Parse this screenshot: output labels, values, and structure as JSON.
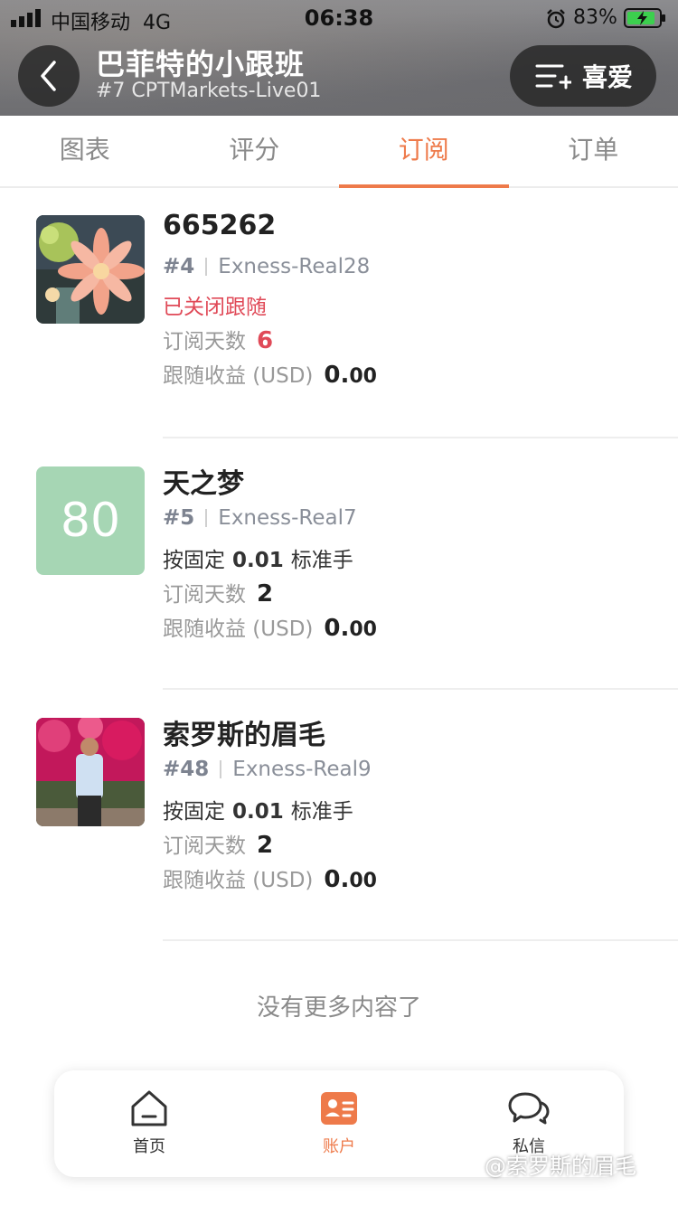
{
  "status_bar": {
    "carrier": "中国移动",
    "network": "4G",
    "time": "06:38",
    "battery": "83%"
  },
  "header": {
    "title": "巴菲特的小跟班",
    "subtitle": "#7 CPTMarkets-Live01",
    "favorite_label": "喜爱"
  },
  "tabs": [
    {
      "label": "图表",
      "active": false
    },
    {
      "label": "评分",
      "active": false
    },
    {
      "label": "订阅",
      "active": true
    },
    {
      "label": "订单",
      "active": false
    }
  ],
  "subscriptions": [
    {
      "name": "665262",
      "rank": "#4",
      "account": "Exness-Real28",
      "status": "已关闭跟随",
      "days_label": "订阅天数",
      "days": "6",
      "profit_label": "跟随收益 (USD)",
      "profit_int": "0.",
      "profit_dec": "00"
    },
    {
      "name": "天之梦",
      "avatar_text": "80",
      "rank": "#5",
      "account": "Exness-Real7",
      "mode_prefix": "按固定",
      "mode_value": "0.01",
      "mode_suffix": "标准手",
      "days_label": "订阅天数",
      "days": "2",
      "profit_label": "跟随收益 (USD)",
      "profit_int": "0.",
      "profit_dec": "00"
    },
    {
      "name": "索罗斯的眉毛",
      "rank": "#48",
      "account": "Exness-Real9",
      "mode_prefix": "按固定",
      "mode_value": "0.01",
      "mode_suffix": "标准手",
      "days_label": "订阅天数",
      "days": "2",
      "profit_label": "跟随收益 (USD)",
      "profit_int": "0.",
      "profit_dec": "00"
    }
  ],
  "end_text": "没有更多内容了",
  "bottom_nav": [
    {
      "label": "首页",
      "icon": "home-icon",
      "active": false
    },
    {
      "label": "账户",
      "icon": "account-card-icon",
      "active": true
    },
    {
      "label": "私信",
      "icon": "chat-bubbles-icon",
      "active": false
    }
  ],
  "watermark": "@索罗斯的眉毛",
  "colors": {
    "accent": "#ee7a4a",
    "danger": "#e04a58",
    "avatar_green": "#a6d6b4"
  }
}
